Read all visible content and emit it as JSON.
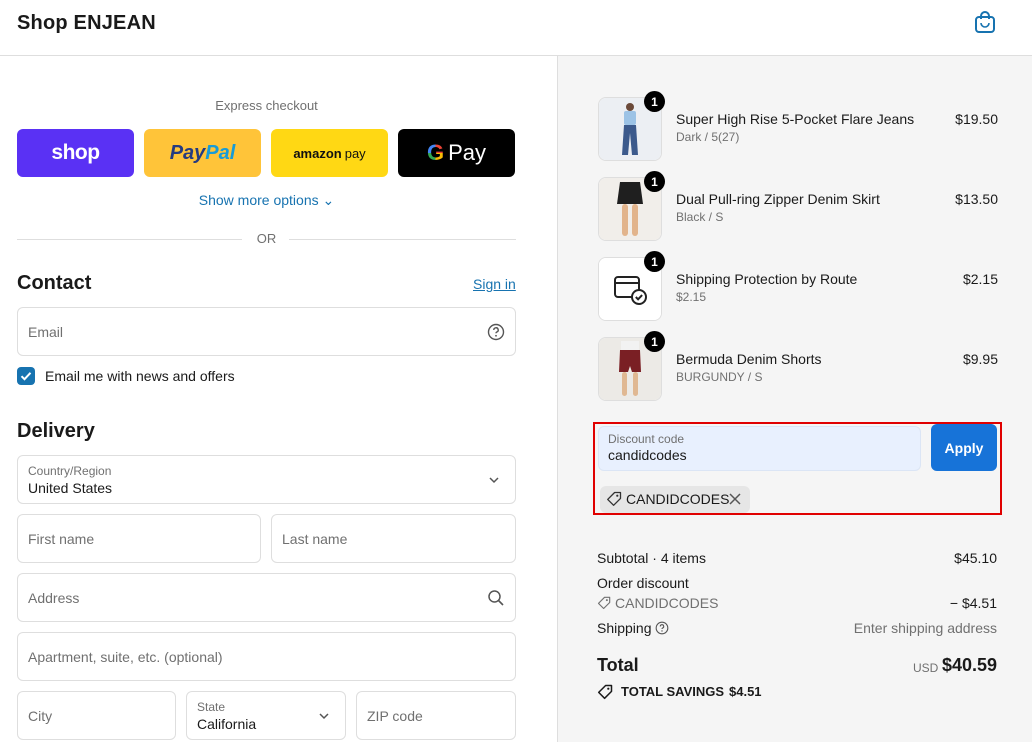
{
  "header": {
    "store_name": "Shop ENJEAN"
  },
  "express": {
    "label": "Express checkout",
    "shop_label": "shop",
    "paypal_a": "Pay",
    "paypal_b": "Pal",
    "amazon_a": "amazon",
    "amazon_b": "pay",
    "gpay_g": "G",
    "gpay_label": "Pay",
    "more_options": "Show more options ⌄",
    "or": "OR"
  },
  "contact": {
    "title": "Contact",
    "sign_in": "Sign in",
    "email_placeholder": "Email",
    "news_label": "Email me with news and offers",
    "news_checked": true
  },
  "delivery": {
    "title": "Delivery",
    "country_label": "Country/Region",
    "country_value": "United States",
    "first_name": "First name",
    "last_name": "Last name",
    "address": "Address",
    "apartment": "Apartment, suite, etc. (optional)",
    "city": "City",
    "state_label": "State",
    "state_value": "California",
    "zip": "ZIP code"
  },
  "cart": {
    "items": [
      {
        "name": "Super High Rise 5-Pocket Flare Jeans",
        "variant": "Dark / 5(27)",
        "price": "$19.50",
        "qty": "1"
      },
      {
        "name": "Dual Pull-ring Zipper Denim Skirt",
        "variant": "Black / S",
        "price": "$13.50",
        "qty": "1"
      },
      {
        "name": "Shipping Protection by Route",
        "variant": "$2.15",
        "price": "$2.15",
        "qty": "1"
      },
      {
        "name": "Bermuda Denim Shorts",
        "variant": "BURGUNDY / S",
        "price": "$9.95",
        "qty": "1"
      }
    ]
  },
  "discount": {
    "label": "Discount code",
    "value": "candidcodes",
    "apply": "Apply",
    "applied_code": "CANDIDCODES"
  },
  "summary": {
    "subtotal_label": "Subtotal · 4 items",
    "subtotal_value": "$45.10",
    "order_discount_label": "Order discount",
    "discount_code": "CANDIDCODES",
    "discount_value": "− $4.51",
    "shipping_label": "Shipping",
    "shipping_value": "Enter shipping address",
    "total_label": "Total",
    "currency": "USD",
    "total_value": "$40.59",
    "savings_label": "TOTAL SAVINGS",
    "savings_value": "$4.51"
  }
}
